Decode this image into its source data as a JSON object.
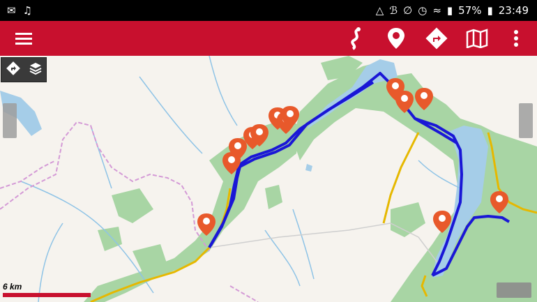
{
  "status_bar": {
    "notification_icons": [
      "missed-call-icon",
      "music-note-icon"
    ],
    "system_icons": [
      "warning-icon",
      "bluetooth-icon",
      "mute-icon",
      "alarm-icon",
      "wifi-icon",
      "signal-icon"
    ],
    "battery": "57%",
    "time": "23:49"
  },
  "toolbar": {
    "menu_icon": "hamburger-menu-icon",
    "actions": [
      "route-icon",
      "map-pin-icon",
      "directions-icon",
      "map-icon",
      "overflow-menu-icon"
    ],
    "color": "#c8102e"
  },
  "map": {
    "controls": [
      "directions-icon",
      "layers-icon"
    ],
    "scale_label": "6 km",
    "marker_count": 14,
    "route_color": "#1a17d6",
    "marker_color": "#e8592b"
  }
}
